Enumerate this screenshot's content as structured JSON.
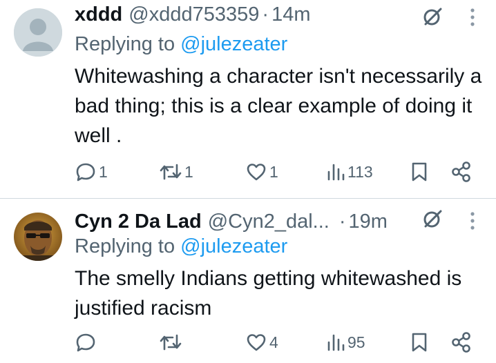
{
  "tweets": [
    {
      "name": "xddd",
      "handle": "@xddd753359",
      "separator": "·",
      "time": "14m",
      "reply_prefix": "Replying to ",
      "reply_to": "@julezeater",
      "text": "Whitewashing a character isn't necessarily a bad thing; this is a clear example of doing it well .",
      "replies": "1",
      "reposts": "1",
      "likes": "1",
      "views": "113",
      "icons": [
        "grok-icon",
        "more-icon",
        "reply-icon",
        "repost-icon",
        "like-icon",
        "views-icon",
        "bookmark-icon",
        "share-icon"
      ]
    },
    {
      "name": "Cyn 2 Da Lad",
      "handle": "@Cyn2_dal...",
      "separator": "·",
      "time": "19m",
      "reply_prefix": "Replying to ",
      "reply_to": "@julezeater",
      "text": "The smelly Indians getting whitewashed is justified racism",
      "replies": "",
      "reposts": "",
      "likes": "4",
      "views": "95",
      "icons": [
        "grok-icon",
        "more-icon",
        "reply-icon",
        "repost-icon",
        "like-icon",
        "views-icon",
        "bookmark-icon",
        "share-icon"
      ]
    }
  ],
  "colors": {
    "text": "#0f1419",
    "secondary": "#536471",
    "link": "#1d9bf0",
    "divider": "#cfd9de"
  }
}
